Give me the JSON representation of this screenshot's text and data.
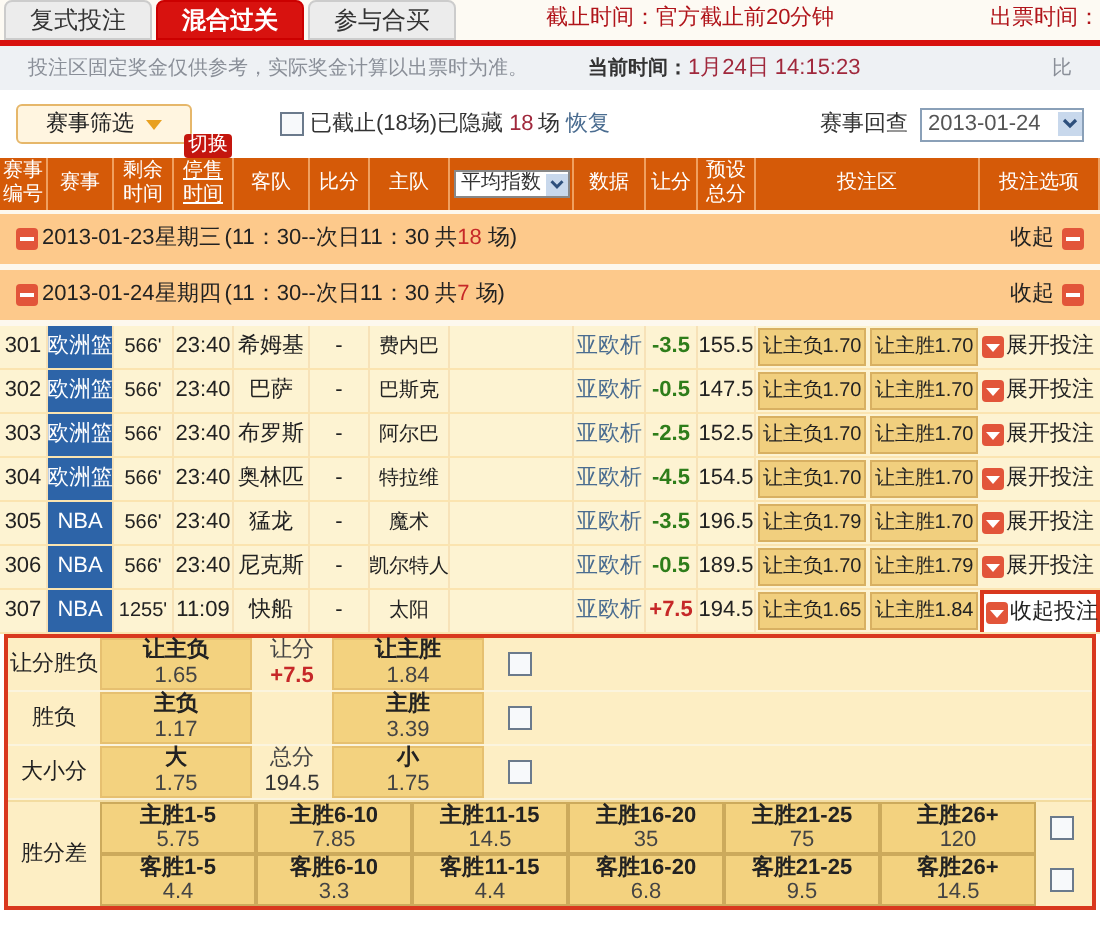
{
  "tabs": [
    {
      "label": "复式投注",
      "selected": false
    },
    {
      "label": "混合过关",
      "selected": true
    },
    {
      "label": "参与合买",
      "selected": false
    }
  ],
  "deadline": {
    "label": "截止时间：",
    "value": "官方截止前20分钟"
  },
  "ticket_time": {
    "label": "出票时间："
  },
  "notice": "投注区固定奖金仅供参考，实际奖金计算以出票时为准。",
  "current_time": {
    "label": "当前时间：",
    "value": "1月24日 14:15:23"
  },
  "notice_cut": "比",
  "filter": {
    "button": "赛事筛选",
    "checked": false,
    "label": "已截止(18场)已隐藏",
    "hidden_count": "18",
    "unit": "场",
    "restore": "恢复",
    "review_label": "赛事回查",
    "review_date": "2013-01-24"
  },
  "switch_badge": "切换",
  "columns": [
    "赛事编号",
    "赛事",
    "剩余时间",
    "停售时间",
    "客队",
    "比分",
    "主队",
    "平均指数",
    "数据",
    "让分",
    "预设总分",
    "投注区",
    "投注选项"
  ],
  "groups": [
    {
      "date": "2013-01-23星期三",
      "range": "(11：30--次日11：30 共",
      "count": "18",
      "unit": "场)",
      "toggle": "收起",
      "expanded": true
    },
    {
      "date": "2013-01-24星期四",
      "range": "(11：30--次日11：30 共",
      "count": "7",
      "unit": "场)",
      "toggle": "收起",
      "expanded": true
    }
  ],
  "matches": [
    {
      "id": "301",
      "league": "欧洲篮",
      "remaining": "566'",
      "stop": "23:40",
      "away": "希姆基",
      "score": "-",
      "home": "费内巴",
      "data": "亚欧析",
      "handicap": "-3.5",
      "color": "#2e7d1a",
      "total": "155.5",
      "bets": [
        "让主负1.70",
        "让主胜1.70"
      ],
      "option": "展开投注",
      "expanded": false
    },
    {
      "id": "302",
      "league": "欧洲篮",
      "remaining": "566'",
      "stop": "23:40",
      "away": "巴萨",
      "score": "-",
      "home": "巴斯克",
      "data": "亚欧析",
      "handicap": "-0.5",
      "color": "#2e7d1a",
      "total": "147.5",
      "bets": [
        "让主负1.70",
        "让主胜1.70"
      ],
      "option": "展开投注",
      "expanded": false
    },
    {
      "id": "303",
      "league": "欧洲篮",
      "remaining": "566'",
      "stop": "23:40",
      "away": "布罗斯",
      "score": "-",
      "home": "阿尔巴",
      "data": "亚欧析",
      "handicap": "-2.5",
      "color": "#2e7d1a",
      "total": "152.5",
      "bets": [
        "让主负1.70",
        "让主胜1.70"
      ],
      "option": "展开投注",
      "expanded": false
    },
    {
      "id": "304",
      "league": "欧洲篮",
      "remaining": "566'",
      "stop": "23:40",
      "away": "奥林匹",
      "score": "-",
      "home": "特拉维",
      "data": "亚欧析",
      "handicap": "-4.5",
      "color": "#2e7d1a",
      "total": "154.5",
      "bets": [
        "让主负1.70",
        "让主胜1.70"
      ],
      "option": "展开投注",
      "expanded": false
    },
    {
      "id": "305",
      "league": "NBA",
      "remaining": "566'",
      "stop": "23:40",
      "away": "猛龙",
      "score": "-",
      "home": "魔术",
      "data": "亚欧析",
      "handicap": "-3.5",
      "color": "#2e7d1a",
      "total": "196.5",
      "bets": [
        "让主负1.79",
        "让主胜1.70"
      ],
      "option": "展开投注",
      "expanded": false
    },
    {
      "id": "306",
      "league": "NBA",
      "remaining": "566'",
      "stop": "23:40",
      "away": "尼克斯",
      "score": "-",
      "home": "凯尔特人",
      "data": "亚欧析",
      "handicap": "-0.5",
      "color": "#2e7d1a",
      "total": "189.5",
      "bets": [
        "让主负1.70",
        "让主胜1.79"
      ],
      "option": "展开投注",
      "expanded": false
    },
    {
      "id": "307",
      "league": "NBA",
      "remaining": "1255'",
      "stop": "11:09",
      "away": "快船",
      "score": "-",
      "home": "太阳",
      "data": "亚欧析",
      "handicap": "+7.5",
      "color": "#c62828",
      "total": "194.5",
      "bets": [
        "让主负1.65",
        "让主胜1.84"
      ],
      "option": "收起投注",
      "expanded": true
    }
  ],
  "bet_panel": [
    {
      "kind": "pair",
      "label": "让分胜负",
      "left": {
        "label": "让主负",
        "odds": "1.65"
      },
      "middle": {
        "label": "让分",
        "value": "+7.5",
        "highlight": true
      },
      "right": {
        "label": "让主胜",
        "odds": "1.84"
      },
      "checked": false
    },
    {
      "kind": "pair",
      "label": "胜负",
      "left": {
        "label": "主负",
        "odds": "1.17"
      },
      "right": {
        "label": "主胜",
        "odds": "3.39"
      },
      "checked": false
    },
    {
      "kind": "pair",
      "label": "大小分",
      "left": {
        "label": "大",
        "odds": "1.75"
      },
      "middle": {
        "label": "总分",
        "value": "194.5",
        "highlight": false
      },
      "right": {
        "label": "小",
        "odds": "1.75"
      },
      "checked": false
    },
    {
      "kind": "grid",
      "label": "胜分差",
      "lines": [
        {
          "checked": false,
          "cells": [
            {
              "label": "主胜1-5",
              "odds": "5.75"
            },
            {
              "label": "主胜6-10",
              "odds": "7.85"
            },
            {
              "label": "主胜11-15",
              "odds": "14.5"
            },
            {
              "label": "主胜16-20",
              "odds": "35"
            },
            {
              "label": "主胜21-25",
              "odds": "75"
            },
            {
              "label": "主胜26+",
              "odds": "120"
            }
          ]
        },
        {
          "checked": false,
          "cells": [
            {
              "label": "客胜1-5",
              "odds": "4.4"
            },
            {
              "label": "客胜6-10",
              "odds": "3.3"
            },
            {
              "label": "客胜11-15",
              "odds": "4.4"
            },
            {
              "label": "客胜16-20",
              "odds": "6.8"
            },
            {
              "label": "客胜21-25",
              "odds": "9.5"
            },
            {
              "label": "客胜26+",
              "odds": "14.5"
            }
          ]
        }
      ]
    }
  ]
}
